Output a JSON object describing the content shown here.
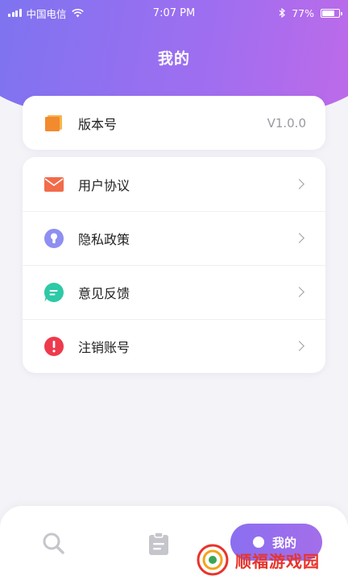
{
  "status_bar": {
    "carrier": "中国电信",
    "time": "7:07 PM",
    "battery": "77%",
    "battery_level": 0.77
  },
  "page": {
    "title": "我的"
  },
  "version_card": {
    "icon": "book-icon",
    "label": "版本号",
    "value": "V1.0.0"
  },
  "menu": {
    "items": [
      {
        "icon": "mail-icon",
        "label": "用户协议",
        "color": "#f26b4a"
      },
      {
        "icon": "lock-icon",
        "label": "隐私政策",
        "color": "#8d8ff2"
      },
      {
        "icon": "chat-icon",
        "label": "意见反馈",
        "color": "#2ec9a6"
      },
      {
        "icon": "alert-icon",
        "label": "注销账号",
        "color": "#ee3a4d"
      }
    ]
  },
  "bottom_nav": {
    "items": [
      {
        "icon": "search-icon"
      },
      {
        "icon": "clipboard-icon"
      },
      {
        "icon": "person-icon",
        "label": "我的",
        "active": true
      }
    ]
  },
  "watermark": {
    "text": "顺福游戏园",
    "color": "#e8342b"
  },
  "colors": {
    "accent_start": "#7b74f0",
    "accent_end": "#c06ae8",
    "background": "#f4f4f8"
  }
}
